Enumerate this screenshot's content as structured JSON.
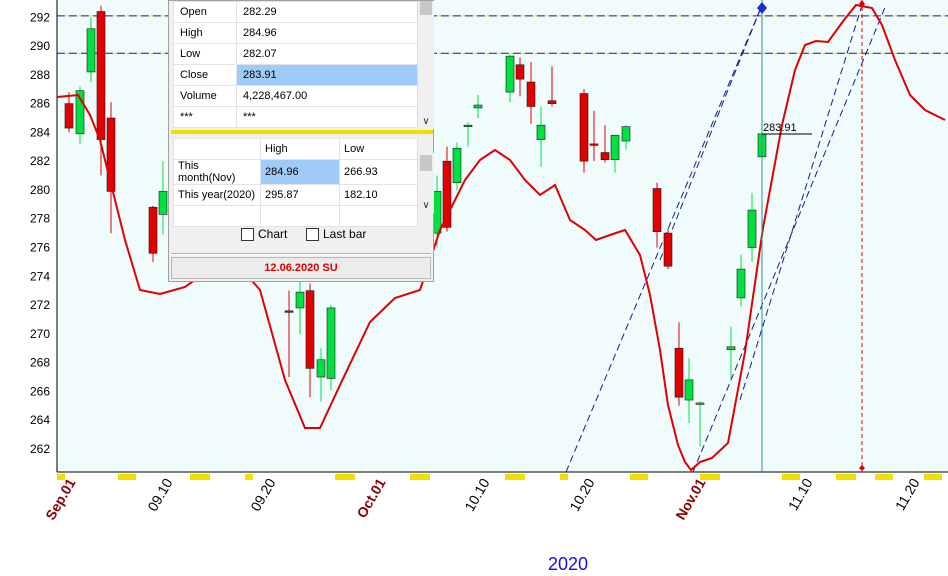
{
  "colors": {
    "background": "#f0fcfc",
    "up": "#00e040",
    "down": "#e00000",
    "ma_line": "#e00000",
    "month_label": "#8b0000",
    "year_label": "#1010e0",
    "highlight": "#9ecbf8"
  },
  "chart_data": {
    "type": "candlestick",
    "y_ticks": [
      "262",
      "264",
      "266",
      "268",
      "270",
      "272",
      "274",
      "276",
      "278",
      "280",
      "282",
      "284",
      "286",
      "288",
      "290",
      "292"
    ],
    "ylim": [
      260.4,
      293.2
    ],
    "x_labels": [
      {
        "text": "Sep.01",
        "kind": "month"
      },
      {
        "text": "09.10",
        "kind": "day"
      },
      {
        "text": "09.20",
        "kind": "day"
      },
      {
        "text": "Oct.01",
        "kind": "month"
      },
      {
        "text": "10.10",
        "kind": "day"
      },
      {
        "text": "10.20",
        "kind": "day"
      },
      {
        "text": "Nov.01",
        "kind": "month"
      },
      {
        "text": "11.10",
        "kind": "day"
      },
      {
        "text": "11.20",
        "kind": "day"
      }
    ],
    "year_label": "2020",
    "last_price_label": "283.91",
    "horizontal_levels": [
      292.1,
      289.5
    ],
    "candles": [
      {
        "o": 286.0,
        "h": 286.8,
        "l": 284.0,
        "c": 284.3
      },
      {
        "o": 283.9,
        "h": 287.2,
        "l": 283.2,
        "c": 286.9
      },
      {
        "o": 288.2,
        "h": 292.0,
        "l": 287.5,
        "c": 291.2
      },
      {
        "o": 292.4,
        "h": 292.8,
        "l": 281.0,
        "c": 283.5
      },
      {
        "o": 285.0,
        "h": 286.1,
        "l": 277.0,
        "c": 279.9
      },
      {
        "o": 278.8,
        "h": 278.9,
        "l": 275.0,
        "c": 275.6
      },
      {
        "o": 278.3,
        "h": 282.0,
        "l": 276.9,
        "c": 279.9
      },
      {
        "o": 271.6,
        "h": 273.0,
        "l": 267.0,
        "c": 271.5
      },
      {
        "o": 271.8,
        "h": 275.0,
        "l": 270.0,
        "c": 272.9
      },
      {
        "o": 273.0,
        "h": 273.5,
        "l": 265.6,
        "c": 267.6
      },
      {
        "o": 267.0,
        "h": 269.0,
        "l": 265.3,
        "c": 268.2
      },
      {
        "o": 266.9,
        "h": 272.0,
        "l": 266.1,
        "c": 271.8
      },
      {
        "o": 277.0,
        "h": 281.0,
        "l": 276.0,
        "c": 279.9
      },
      {
        "o": 282.0,
        "h": 283.0,
        "l": 277.1,
        "c": 277.4
      },
      {
        "o": 280.5,
        "h": 283.3,
        "l": 280.0,
        "c": 282.9
      },
      {
        "o": 284.4,
        "h": 284.7,
        "l": 283.0,
        "c": 284.5
      },
      {
        "o": 285.7,
        "h": 286.6,
        "l": 285.0,
        "c": 285.9
      },
      {
        "o": 286.8,
        "h": 289.4,
        "l": 286.1,
        "c": 289.3
      },
      {
        "o": 288.7,
        "h": 289.2,
        "l": 286.5,
        "c": 287.7
      },
      {
        "o": 287.5,
        "h": 288.9,
        "l": 284.6,
        "c": 285.8
      },
      {
        "o": 283.5,
        "h": 285.8,
        "l": 281.6,
        "c": 284.5
      },
      {
        "o": 286.2,
        "h": 288.6,
        "l": 285.8,
        "c": 286.0
      },
      {
        "o": 286.7,
        "h": 287.0,
        "l": 281.2,
        "c": 282.0
      },
      {
        "o": 283.2,
        "h": 285.5,
        "l": 282.0,
        "c": 283.1
      },
      {
        "o": 282.6,
        "h": 284.5,
        "l": 281.9,
        "c": 282.1
      },
      {
        "o": 282.1,
        "h": 283.5,
        "l": 281.2,
        "c": 283.8
      },
      {
        "o": 283.4,
        "h": 284.5,
        "l": 282.8,
        "c": 284.4
      },
      {
        "o": 280.1,
        "h": 280.5,
        "l": 276.0,
        "c": 277.1
      },
      {
        "o": 277.0,
        "h": 277.3,
        "l": 274.5,
        "c": 274.7
      },
      {
        "o": 269.0,
        "h": 270.8,
        "l": 265.0,
        "c": 265.6
      },
      {
        "o": 265.4,
        "h": 268.3,
        "l": 263.8,
        "c": 266.8
      },
      {
        "o": 265.2,
        "h": 265.3,
        "l": 262.2,
        "c": 265.2
      },
      {
        "o": 268.9,
        "h": 270.5,
        "l": 266.8,
        "c": 269.1
      },
      {
        "o": 272.5,
        "h": 275.5,
        "l": 271.9,
        "c": 274.5
      },
      {
        "o": 276.0,
        "h": 279.8,
        "l": 275.0,
        "c": 278.6
      },
      {
        "o": 282.3,
        "h": 284.9,
        "l": 282.1,
        "c": 283.9
      }
    ]
  },
  "info_panel": {
    "ohlc": [
      {
        "label": "Open",
        "value": "282.29"
      },
      {
        "label": "High",
        "value": "284.96"
      },
      {
        "label": "Low",
        "value": "282.07"
      },
      {
        "label": "Close",
        "value": "283.91"
      },
      {
        "label": "Volume",
        "value": "4,228,467.00"
      },
      {
        "label": "***",
        "value": "***"
      }
    ],
    "range_header": {
      "high": "High",
      "low": "Low"
    },
    "range_rows": [
      {
        "label": "This month(Nov)",
        "high": "284.96",
        "low": "266.93"
      },
      {
        "label": "This year(2020)",
        "high": "295.87",
        "low": "182.10"
      }
    ],
    "chart_checkbox_label": "Chart",
    "lastbar_checkbox_label": "Last bar",
    "date_text": "12.06.2020 SU"
  }
}
